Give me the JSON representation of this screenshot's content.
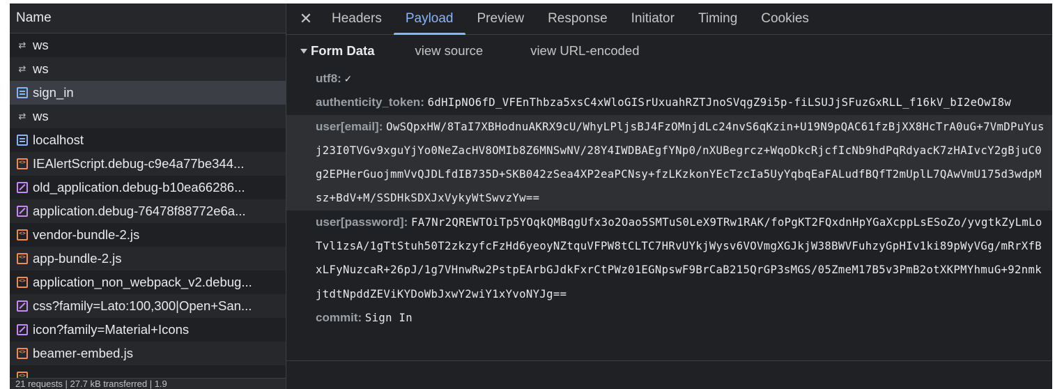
{
  "request_list": {
    "header": "Name",
    "items": [
      {
        "icon": "websocket-icon",
        "name": "ws"
      },
      {
        "icon": "websocket-icon",
        "name": "ws"
      },
      {
        "icon": "document-icon",
        "name": "sign_in"
      },
      {
        "icon": "websocket-icon",
        "name": "ws"
      },
      {
        "icon": "document-icon",
        "name": "localhost"
      },
      {
        "icon": "script-icon",
        "name": "IEAlertScript.debug-c9e4a77be344..."
      },
      {
        "icon": "stylesheet-icon",
        "name": "old_application.debug-b10ea66286..."
      },
      {
        "icon": "stylesheet-icon",
        "name": "application.debug-76478f88772e6a..."
      },
      {
        "icon": "script-icon",
        "name": "vendor-bundle-2.js"
      },
      {
        "icon": "script-icon",
        "name": "app-bundle-2.js"
      },
      {
        "icon": "script-icon",
        "name": "application_non_webpack_v2.debug..."
      },
      {
        "icon": "stylesheet-icon",
        "name": "css?family=Lato:100,300|Open+San..."
      },
      {
        "icon": "stylesheet-icon",
        "name": "icon?family=Material+Icons"
      },
      {
        "icon": "script-icon",
        "name": "beamer-embed.js"
      },
      {
        "icon": "script-icon",
        "name": ""
      }
    ],
    "selected_index": 2,
    "status_bar": "21 requests   |   27.7 kB transferred   |   1.9"
  },
  "tabs": {
    "close": "✕",
    "items": [
      "Headers",
      "Payload",
      "Preview",
      "Response",
      "Initiator",
      "Timing",
      "Cookies"
    ],
    "active": "Payload"
  },
  "form_data": {
    "title": "Form Data",
    "view_source": "view source",
    "view_url_encoded": "view URL-encoded",
    "fields": [
      {
        "key": "utf8:",
        "value": "✓"
      },
      {
        "key": "authenticity_token:",
        "value": "6dHIpNO6fD_VFEnThbza5xsC4xWloGISrUxuahRZTJnoSVqgZ9i5p-fiLSUJjSFuzGxRLL_f16kV_bI2eOwI8w"
      },
      {
        "key": "user[email]:",
        "value": "OwSQpxHW/8TaI7XBHodnuAKRX9cU/WhyLPljsBJ4FzOMnjdLc24nvS6qKzin+U19N9pQAC61fzBjXX8HcTrA0uG+7VmDPuYusj23I0TVGv9xguYjYo0NeZacHV8OMIb8Z6MNSwNV/28Y4IWDBAEgfYNp0/nXUBegrcz+WqoDkcRjcfIcNb9hdPqRdyacK7zHAIvcY2gBjuC0g2EPHerGuojmmVvQJDLfdIB735D+SKB042zSea4XP2eaPCNsy+fzLKzkonYEcTzcIa5UyYqbqEaFALudfBQfT2mUplL7QAwVmU175d3wdpMsz+BdV+M/SSDHkSDXJxVykyWtSwvzYw=="
      },
      {
        "key": "user[password]:",
        "value": "FA7Nr2QREWTOiTp5YOqkQMBqgUfx3o2Oao5SMTuS0LeX9TRw1RAK/foPgKT2FQxdnHpYGaXcppLsESoZo/yvgtkZyLmLoTvl1zsA/1gTtStuh50T2zkzyfcFzHd6yeoyNZtquVFPW8tCLTC7HRvUYkjWysv6VOVmgXGJkjW38BWVFuhzyGpHIv1ki89pWyVGg/mRrXfBxLFyNuzcaR+26pJ/1g7VHnwRw2PstpEArbGJdkFxrCtPWz01EGNpswF9BrCaB215QrGP3sMGS/05ZmeM17B5v3PmB2otXKPMYhmuG+92nmkjtdtNpddZEViKYDoWbJxwY2wiY1xYvoNYJg=="
      },
      {
        "key": "commit:",
        "value": "Sign In"
      }
    ]
  }
}
